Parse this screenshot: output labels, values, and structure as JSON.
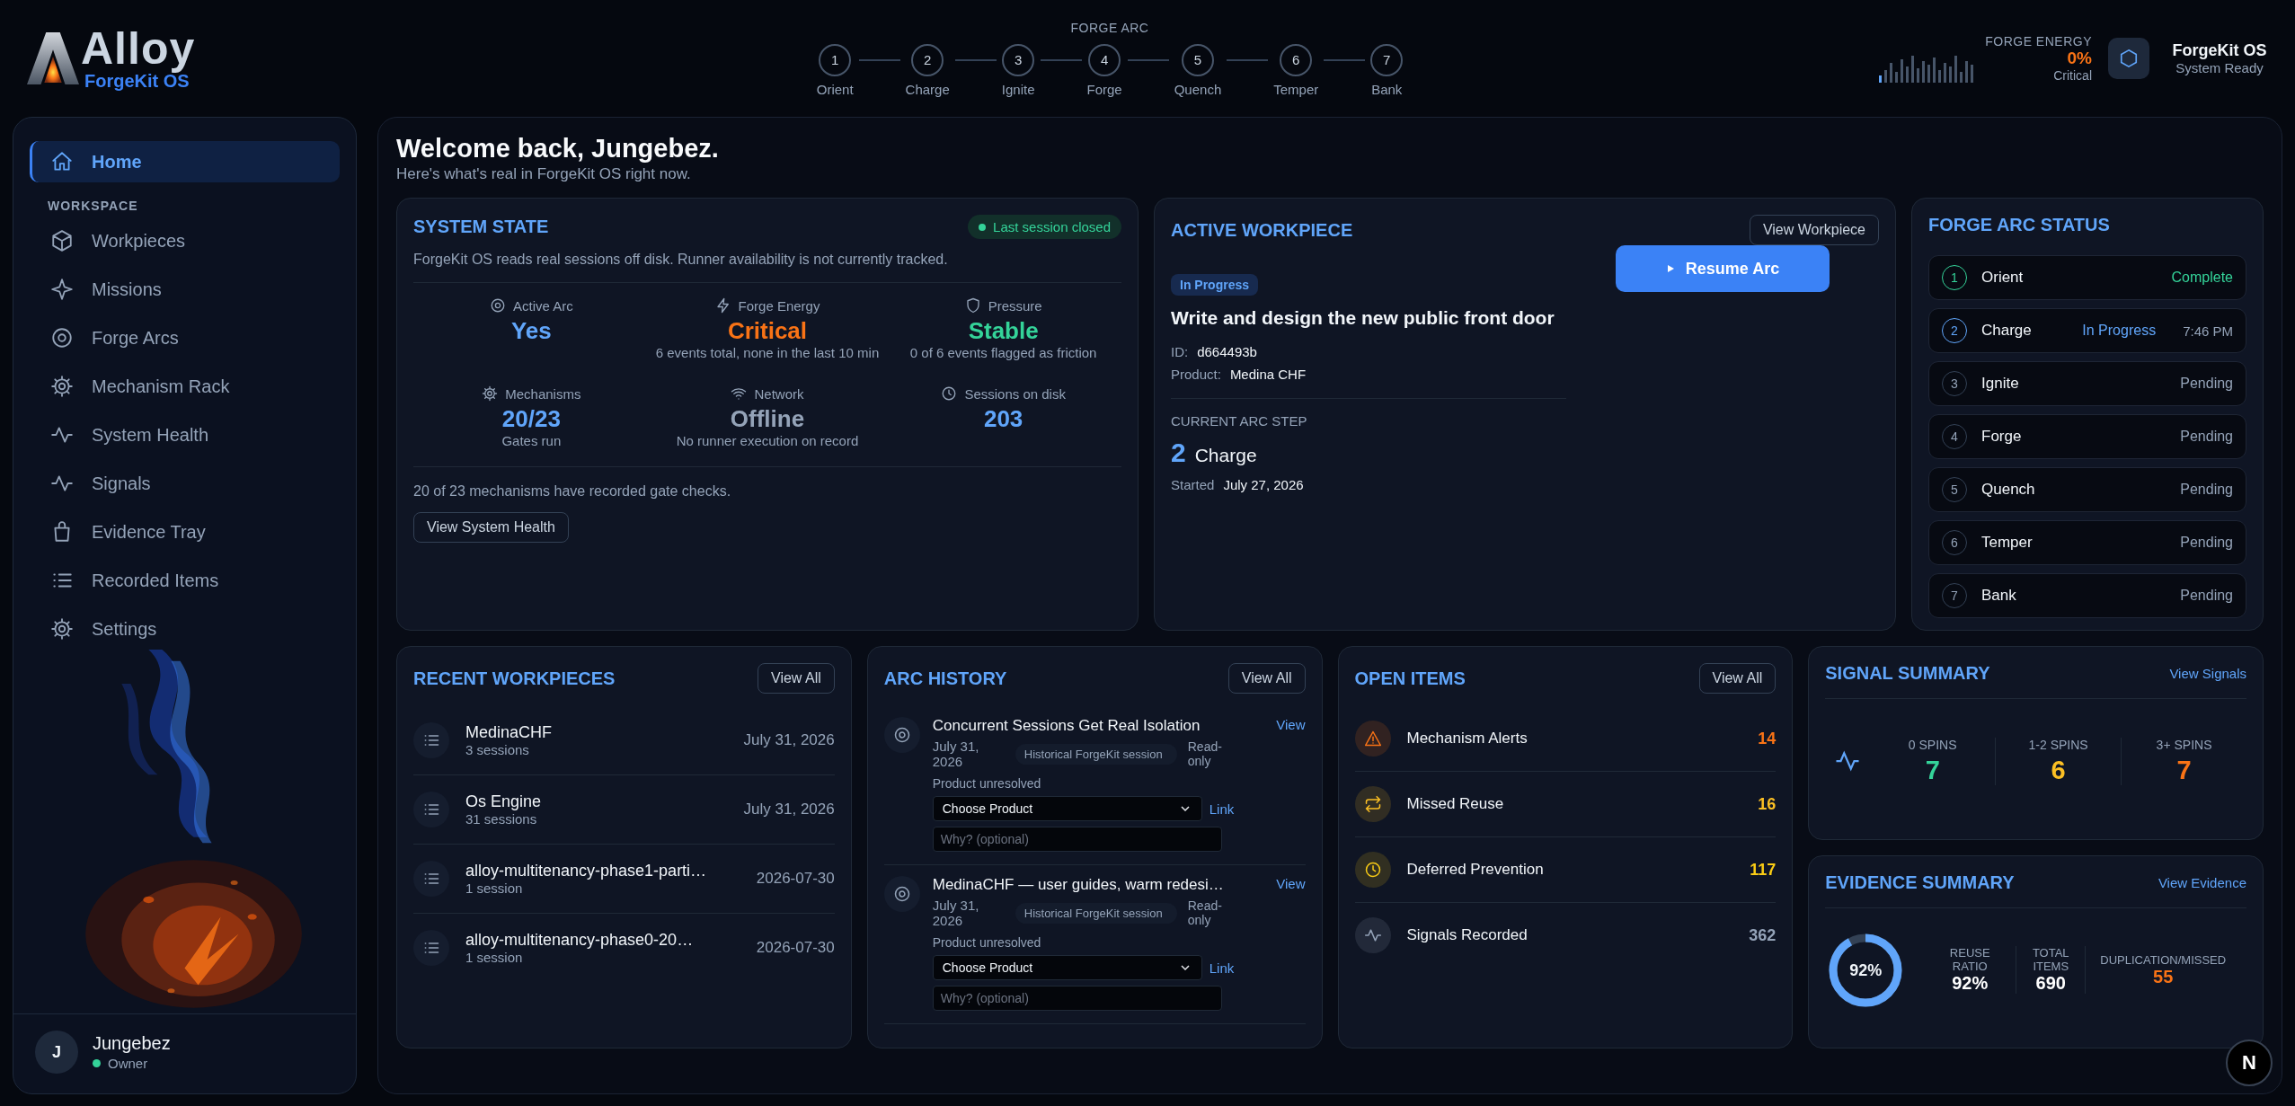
{
  "brand": {
    "name": "Alloy",
    "subtitle": "ForgeKit OS"
  },
  "arc_stepper": {
    "title": "FORGE ARC",
    "steps": [
      {
        "number": "1",
        "label": "Orient"
      },
      {
        "number": "2",
        "label": "Charge"
      },
      {
        "number": "3",
        "label": "Ignite"
      },
      {
        "number": "4",
        "label": "Forge"
      },
      {
        "number": "5",
        "label": "Quench"
      },
      {
        "number": "6",
        "label": "Temper"
      },
      {
        "number": "7",
        "label": "Bank"
      }
    ]
  },
  "forge_energy": {
    "label": "FORGE ENERGY",
    "value": "0%",
    "status": "Critical"
  },
  "system": {
    "name": "ForgeKit OS",
    "status": "System Ready"
  },
  "sidebar": {
    "home": [
      {
        "label": "Home",
        "selected": true
      }
    ],
    "section": "WORKSPACE",
    "items": [
      {
        "label": "Workpieces",
        "selected": false
      },
      {
        "label": "Missions",
        "selected": false
      },
      {
        "label": "Forge Arcs",
        "selected": false
      },
      {
        "label": "Mechanism Rack",
        "selected": false
      },
      {
        "label": "System Health",
        "selected": false
      },
      {
        "label": "Signals",
        "selected": false
      },
      {
        "label": "Evidence Tray",
        "selected": false
      },
      {
        "label": "Recorded Items",
        "selected": false
      },
      {
        "label": "Settings",
        "selected": false
      }
    ],
    "user": {
      "initial": "J",
      "name": "Jungebez",
      "role": "Owner",
      "online": true
    }
  },
  "welcome": {
    "title": "Welcome back, Jungebez.",
    "subtitle": "Here's what's real in ForgeKit OS right now."
  },
  "system_state": {
    "title": "SYSTEM STATE",
    "badge": "Last session closed",
    "description": "ForgeKit OS reads real sessions off disk. Runner availability is not currently tracked.",
    "stats": [
      {
        "label": "Active Arc",
        "value": "Yes",
        "color": "#60a5fa"
      },
      {
        "label": "Forge Energy",
        "value": "Critical",
        "color": "#f97316",
        "note": "6 events total, none in the last 10 min"
      },
      {
        "label": "Pressure",
        "value": "Stable",
        "color": "#34d399",
        "note": "0 of 6 events flagged as friction"
      },
      {
        "label": "Mechanisms",
        "value": "20/23",
        "color": "#60a5fa",
        "note": "Gates run"
      },
      {
        "label": "Network",
        "value": "Offline",
        "color": "#94a3b8",
        "note": "No runner execution on record"
      },
      {
        "label": "Sessions on disk",
        "value": "203",
        "color": "#60a5fa"
      }
    ],
    "footer": "20 of 23 mechanisms have recorded gate checks.",
    "button": "View System Health"
  },
  "active_workpiece": {
    "title": "ACTIVE WORKPIECE",
    "button": "View Workpiece",
    "primary_button": "Resume Arc",
    "status": "In Progress",
    "name": "Write and design the new public front door",
    "id_label": "ID:",
    "id": "d664493b",
    "product_label": "Product:",
    "product": "Medina CHF",
    "step_label": "CURRENT ARC STEP",
    "step_number": "2",
    "step_name": "Charge",
    "started_label": "Started",
    "started": "July 27, 2026"
  },
  "forge_arc_status": {
    "title": "FORGE ARC STATUS",
    "steps": [
      {
        "number": "1",
        "name": "Orient",
        "kind": "complete",
        "status": "Complete"
      },
      {
        "number": "2",
        "name": "Charge",
        "kind": "active",
        "status": "In Progress",
        "time": "7:46 PM"
      },
      {
        "number": "3",
        "name": "Ignite",
        "kind": "pending",
        "status": "Pending"
      },
      {
        "number": "4",
        "name": "Forge",
        "kind": "pending",
        "status": "Pending"
      },
      {
        "number": "5",
        "name": "Quench",
        "kind": "pending",
        "status": "Pending"
      },
      {
        "number": "6",
        "name": "Temper",
        "kind": "pending",
        "status": "Pending"
      },
      {
        "number": "7",
        "name": "Bank",
        "kind": "pending",
        "status": "Pending"
      }
    ]
  },
  "recent_workpieces": {
    "title": "RECENT WORKPIECES",
    "button": "View All",
    "items": [
      {
        "name": "MedinaCHF",
        "sessions": "3 sessions",
        "date": "July 31, 2026"
      },
      {
        "name": "Os Engine",
        "sessions": "31 sessions",
        "date": "July 31, 2026"
      },
      {
        "name": "alloy-multitenancy-phase1-parti…",
        "sessions": "1 session",
        "date": "2026-07-30"
      },
      {
        "name": "alloy-multitenancy-phase0-20…",
        "sessions": "1 session",
        "date": "2026-07-30"
      }
    ]
  },
  "arc_history": {
    "title": "ARC HISTORY",
    "button": "View All",
    "items": [
      {
        "title": "Concurrent Sessions Get Real Isolation",
        "link": "View",
        "date": "July 31, 2026",
        "tag": "Historical ForgeKit session",
        "access": "Read-only",
        "product_note": "Product unresolved",
        "select": "Choose Product",
        "link_button": "Link",
        "placeholder": "Why? (optional)"
      },
      {
        "title": "MedinaCHF — user guides, warm redesi…",
        "link": "View",
        "date": "July 31, 2026",
        "tag": "Historical ForgeKit session",
        "access": "Read-only",
        "product_note": "Product unresolved",
        "select": "Choose Product",
        "link_button": "Link",
        "placeholder": "Why? (optional)"
      }
    ]
  },
  "open_items": {
    "title": "OPEN ITEMS",
    "button": "View All",
    "items": [
      {
        "label": "Mechanism Alerts",
        "count": "14",
        "color": "#f97316"
      },
      {
        "label": "Missed Reuse",
        "count": "16",
        "color": "#fbbf24"
      },
      {
        "label": "Deferred Prevention",
        "count": "117",
        "color": "#facc15"
      },
      {
        "label": "Signals Recorded",
        "count": "362",
        "color": "#94a3b8"
      }
    ]
  },
  "signal_summary": {
    "title": "SIGNAL SUMMARY",
    "link": "View Signals",
    "columns": [
      {
        "label": "0 SPINS",
        "value": "7",
        "color": "#34d399"
      },
      {
        "label": "1-2 SPINS",
        "value": "6",
        "color": "#fbbf24"
      },
      {
        "label": "3+ SPINS",
        "value": "7",
        "color": "#f97316"
      }
    ]
  },
  "evidence_summary": {
    "title": "EVIDENCE SUMMARY",
    "link": "View Evidence",
    "ring": {
      "label": "92%",
      "level": 0.92
    },
    "stats": [
      {
        "label": "REUSE RATIO",
        "value": "92%",
        "color": "#ffffff"
      },
      {
        "label": "TOTAL ITEMS",
        "value": "690",
        "color": "#ffffff"
      },
      {
        "label": "DUPLICATION/MISSED",
        "value": "55",
        "color": "#f97316"
      }
    ]
  },
  "dev_button": "N"
}
